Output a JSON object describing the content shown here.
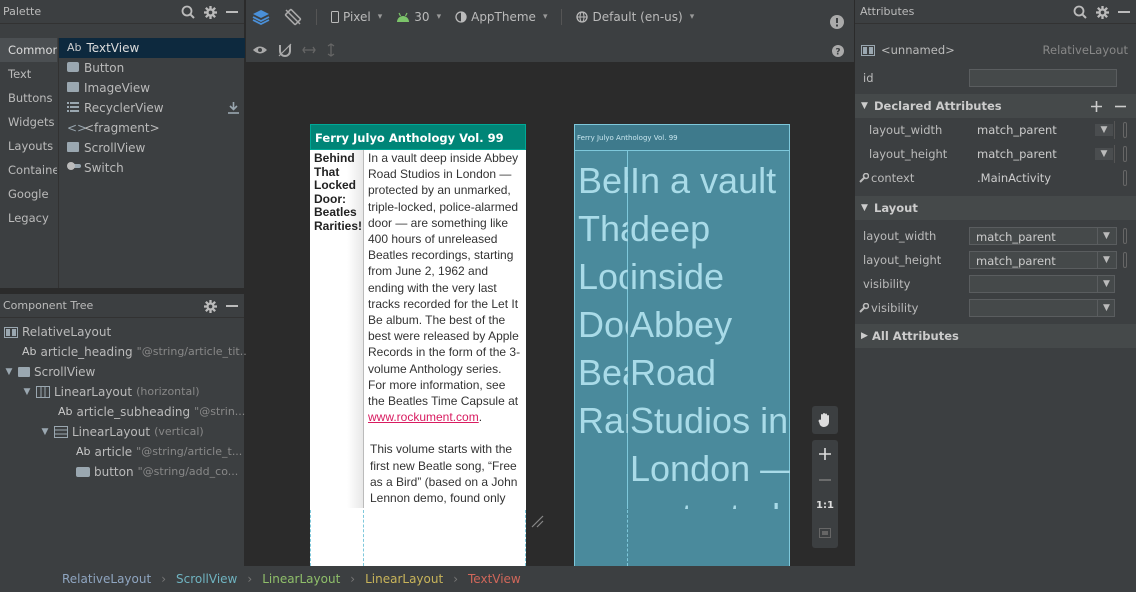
{
  "palette": {
    "title": "Palette",
    "categories": [
      "Common",
      "Text",
      "Buttons",
      "Widgets",
      "Layouts",
      "Containers",
      "Google",
      "Legacy"
    ],
    "widgets": [
      {
        "label": "TextView",
        "prefix": "Ab"
      },
      {
        "label": "Button"
      },
      {
        "label": "ImageView"
      },
      {
        "label": "RecyclerView"
      },
      {
        "label": "<fragment>"
      },
      {
        "label": "ScrollView"
      },
      {
        "label": "Switch"
      }
    ]
  },
  "tree": {
    "title": "Component Tree",
    "rows": [
      {
        "label": "RelativeLayout",
        "hint": ""
      },
      {
        "label": "article_heading",
        "hint": "\"@string/article_tit...",
        "prefix": "Ab"
      },
      {
        "label": "ScrollView",
        "hint": ""
      },
      {
        "label": "LinearLayout",
        "hint": "(horizontal)"
      },
      {
        "label": "article_subheading",
        "hint": "\"@strin...",
        "prefix": "Ab"
      },
      {
        "label": "LinearLayout",
        "hint": "(vertical)"
      },
      {
        "label": "article",
        "hint": "\"@string/article_t...",
        "prefix": "Ab"
      },
      {
        "label": "button",
        "hint": "\"@string/add_co..."
      }
    ]
  },
  "toolbar": {
    "device": "Pixel",
    "api": "30",
    "theme": "AppTheme",
    "locale": "Default (en-us)"
  },
  "design": {
    "title": "Ferry Julyo Anthology Vol. 99",
    "subheading": "Behind That Locked Door: Beatles Rarities!",
    "body_p1": "In a vault deep inside Abbey Road Studios in London — protected by an unmarked, triple-locked, police-alarmed door — are something like 400 hours of unreleased Beatles recordings, starting from June 2, 1962 and ending with the very last tracks recorded for the Let It Be album. The best of the best were released by Apple Records in the form of the 3-volume Anthology series. For more information, see the Beatles Time Capsule at",
    "link": "www.rockument.com",
    "link_tail": ".",
    "body_p2": "This volume starts with the first new Beatle song, “Free as a Bird” (based on a John Lennon demo, found only"
  },
  "blueprint": {
    "title": "Ferry Julyo Anthology Vol. 99",
    "left_col": [
      "Beh",
      "Tha",
      "Loc",
      "Doo",
      "Bea",
      "Rar"
    ],
    "right_col": [
      "In a vault",
      "deep",
      "inside",
      "Abbey",
      "Road",
      "Studios in",
      "London —",
      "protected"
    ]
  },
  "zoom": {
    "one_to_one": "1:1"
  },
  "attributes": {
    "title": "Attributes",
    "component_name": "<unnamed>",
    "component_type": "RelativeLayout",
    "id_label": "id",
    "id_value": "",
    "declared_title": "Declared Attributes",
    "declared": [
      {
        "name": "layout_width",
        "value": "match_parent"
      },
      {
        "name": "layout_height",
        "value": "match_parent"
      },
      {
        "name": "context",
        "value": ".MainActivity"
      }
    ],
    "layout_title": "Layout",
    "layout": [
      {
        "name": "layout_width",
        "value": "match_parent"
      },
      {
        "name": "layout_height",
        "value": "match_parent"
      },
      {
        "name": "visibility",
        "value": ""
      },
      {
        "name": "visibility",
        "value": ""
      }
    ],
    "all_title": "All Attributes"
  },
  "breadcrumb": [
    {
      "label": "RelativeLayout",
      "color": "#8fa5c0"
    },
    {
      "label": "ScrollView",
      "color": "#6fb3c0"
    },
    {
      "label": "LinearLayout",
      "color": "#8fbf6a"
    },
    {
      "label": "LinearLayout",
      "color": "#c8b45a"
    },
    {
      "label": "TextView",
      "color": "#d0675a"
    }
  ]
}
